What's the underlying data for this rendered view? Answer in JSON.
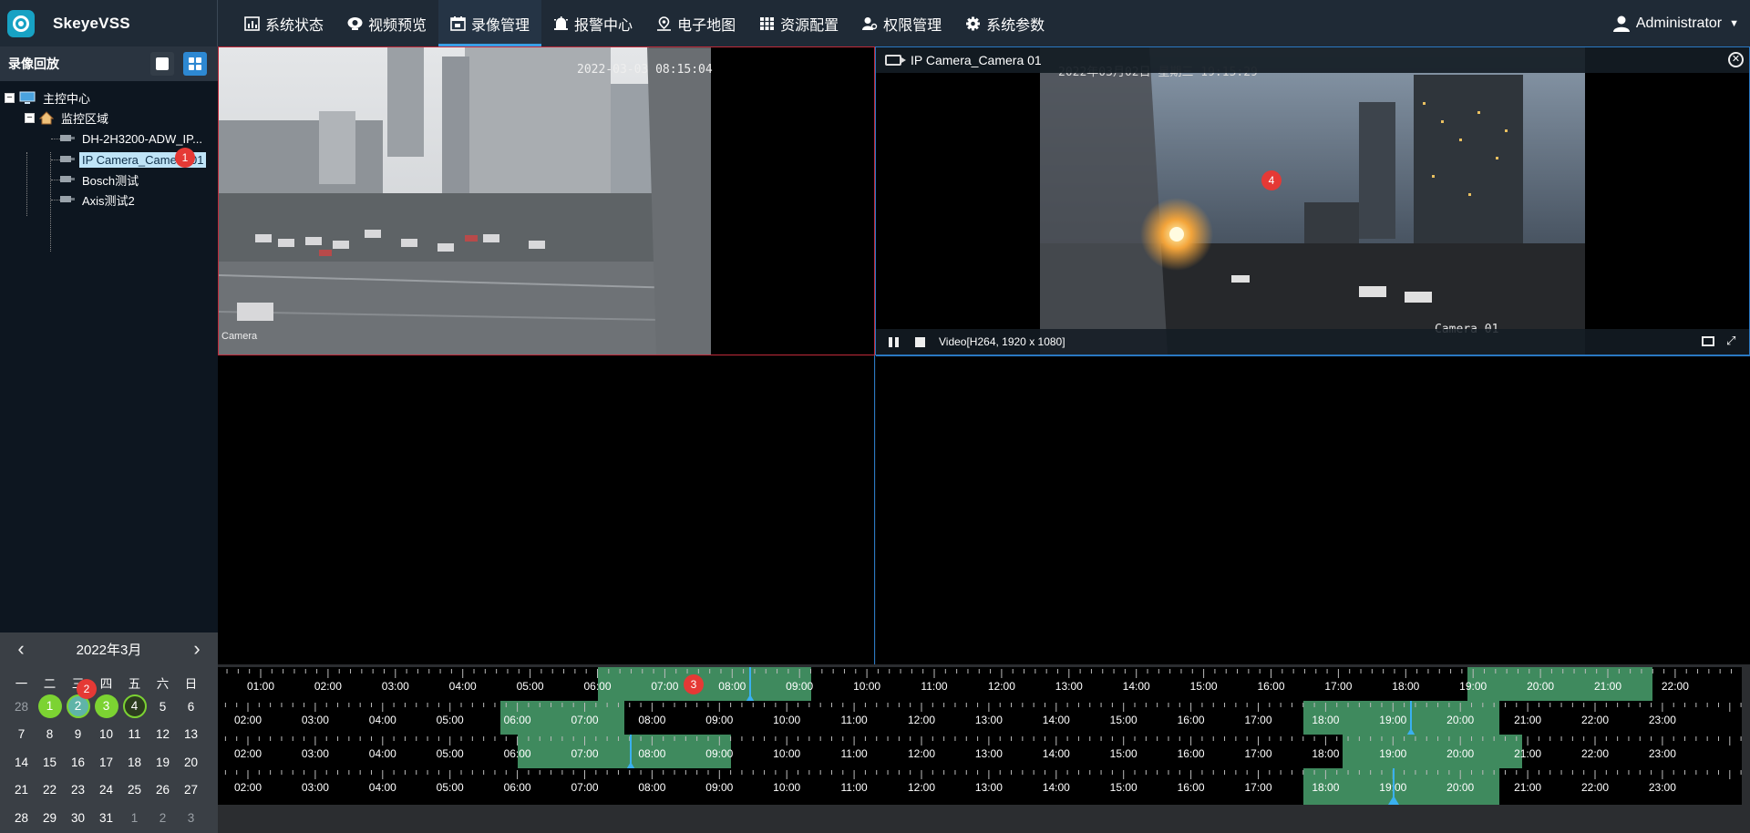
{
  "app": {
    "name": "SkeyeVSS",
    "accent": "#3aa0e6",
    "header_bg": "#1f2a36"
  },
  "nav": [
    {
      "label": "系统状态",
      "icon": "bar-chart-icon"
    },
    {
      "label": "视频预览",
      "icon": "webcam-icon"
    },
    {
      "label": "录像管理",
      "icon": "calendar-icon",
      "active": true
    },
    {
      "label": "报警中心",
      "icon": "alarm-icon"
    },
    {
      "label": "电子地图",
      "icon": "map-pin-icon"
    },
    {
      "label": "资源配置",
      "icon": "grid-list-icon"
    },
    {
      "label": "权限管理",
      "icon": "user-key-icon"
    },
    {
      "label": "系统参数",
      "icon": "gear-icon"
    }
  ],
  "user": {
    "name": "Administrator"
  },
  "sidebar": {
    "title": "录像回放",
    "tree": {
      "root": "主控中心",
      "area": "监控区域",
      "cameras": [
        "DH-2H3200-ADW_IP...",
        "IP Camera_Camera 01",
        "Bosch测试",
        "Axis测试2"
      ],
      "selected": 1
    }
  },
  "calendar": {
    "month_label": "2022年3月",
    "weekdays": [
      "一",
      "二",
      "三",
      "四",
      "五",
      "六",
      "日"
    ],
    "weeks": [
      [
        "28",
        "1",
        "2",
        "3",
        "4",
        "5",
        "6"
      ],
      [
        "7",
        "8",
        "9",
        "10",
        "11",
        "12",
        "13"
      ],
      [
        "14",
        "15",
        "16",
        "17",
        "18",
        "19",
        "20"
      ],
      [
        "21",
        "22",
        "23",
        "24",
        "25",
        "26",
        "27"
      ],
      [
        "28",
        "29",
        "30",
        "31",
        "1",
        "2",
        "3"
      ]
    ],
    "record_days": [
      "1",
      "2",
      "3",
      "4"
    ],
    "selected_day": "2",
    "record_color": "#7cd332"
  },
  "panes": {
    "pane1": {
      "osd_time": "2022-03-03 08:15:04",
      "camera_label": "Camera"
    },
    "pane2": {
      "title": "IP Camera_Camera 01",
      "osd_time": "2022年03月02日  星期三  19:15:29",
      "camera_label": "Camera 01",
      "stream_info": "Video[H264, 1920 x 1080]"
    }
  },
  "badges": [
    "1",
    "2",
    "3",
    "4"
  ],
  "timelines": [
    {
      "labels": [
        "01:00",
        "02:00",
        "03:00",
        "04:00",
        "05:00",
        "06:00",
        "07:00",
        "08:00",
        "09:00",
        "10:00",
        "11:00",
        "12:00",
        "13:00",
        "14:00",
        "15:00",
        "16:00",
        "17:00",
        "18:00",
        "19:00",
        "20:00",
        "21:00",
        "22:00"
      ],
      "segments": [
        [
          "06:00",
          "09:10"
        ],
        [
          "18:55",
          "21:40"
        ]
      ],
      "cursor": "08:15"
    },
    {
      "labels": [
        "02:00",
        "03:00",
        "04:00",
        "05:00",
        "06:00",
        "07:00",
        "08:00",
        "09:00",
        "10:00",
        "11:00",
        "12:00",
        "13:00",
        "14:00",
        "15:00",
        "16:00",
        "17:00",
        "18:00",
        "19:00",
        "20:00",
        "21:00",
        "22:00",
        "23:00"
      ],
      "segments": [
        [
          "05:45",
          "07:35"
        ],
        [
          "17:40",
          "20:35"
        ]
      ],
      "cursor": "19:15"
    },
    {
      "labels": [
        "02:00",
        "03:00",
        "04:00",
        "05:00",
        "06:00",
        "07:00",
        "08:00",
        "09:00",
        "10:00",
        "11:00",
        "12:00",
        "13:00",
        "14:00",
        "15:00",
        "16:00",
        "17:00",
        "18:00",
        "19:00",
        "20:00",
        "21:00",
        "22:00",
        "23:00"
      ],
      "segments": [
        [
          "06:00",
          "09:10"
        ],
        [
          "18:15",
          "20:55"
        ]
      ],
      "cursor": "07:40"
    },
    {
      "labels": [
        "02:00",
        "03:00",
        "04:00",
        "05:00",
        "06:00",
        "07:00",
        "08:00",
        "09:00",
        "10:00",
        "11:00",
        "12:00",
        "13:00",
        "14:00",
        "15:00",
        "16:00",
        "17:00",
        "18:00",
        "19:00",
        "20:00",
        "21:00",
        "22:00",
        "23:00"
      ],
      "segments": [
        [
          "17:40",
          "20:35"
        ]
      ],
      "cursor": "19:00"
    }
  ]
}
